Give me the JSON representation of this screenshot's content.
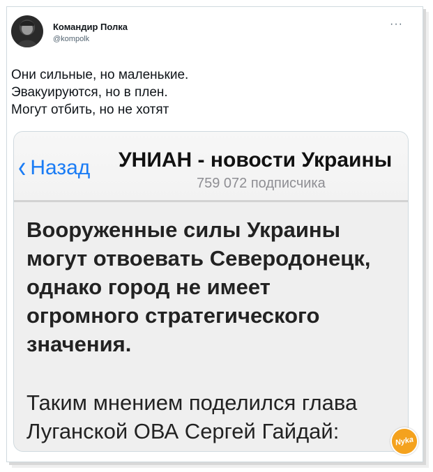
{
  "tweet": {
    "author_name": "Командир Полка",
    "author_handle": "@kompolk",
    "text_lines": [
      "Они сильные, но маленькие.",
      "Эвакуируются, но в плен.",
      "Могут отбить, но не хотят"
    ]
  },
  "screenshot": {
    "back_label": "Назад",
    "channel_name": "УНИАН - новости Украины",
    "subscribers": "759 072 подписчика",
    "headline_lines": [
      "Вооруженные силы Украины",
      "могут отвоевать Северодонецк,",
      "однако город не имеет",
      "огромного стратегического",
      "значения."
    ],
    "body_lines": [
      "Таким мнением поделился глава",
      "Луганской ОВА Сергей Гайдай:"
    ]
  },
  "watermark": {
    "label": "Nyka"
  },
  "colors": {
    "accent": "#1a7cf5",
    "watermark": "#f4a21e"
  },
  "icons": {
    "more": "more-dots-icon",
    "back": "chevron-left-icon"
  }
}
